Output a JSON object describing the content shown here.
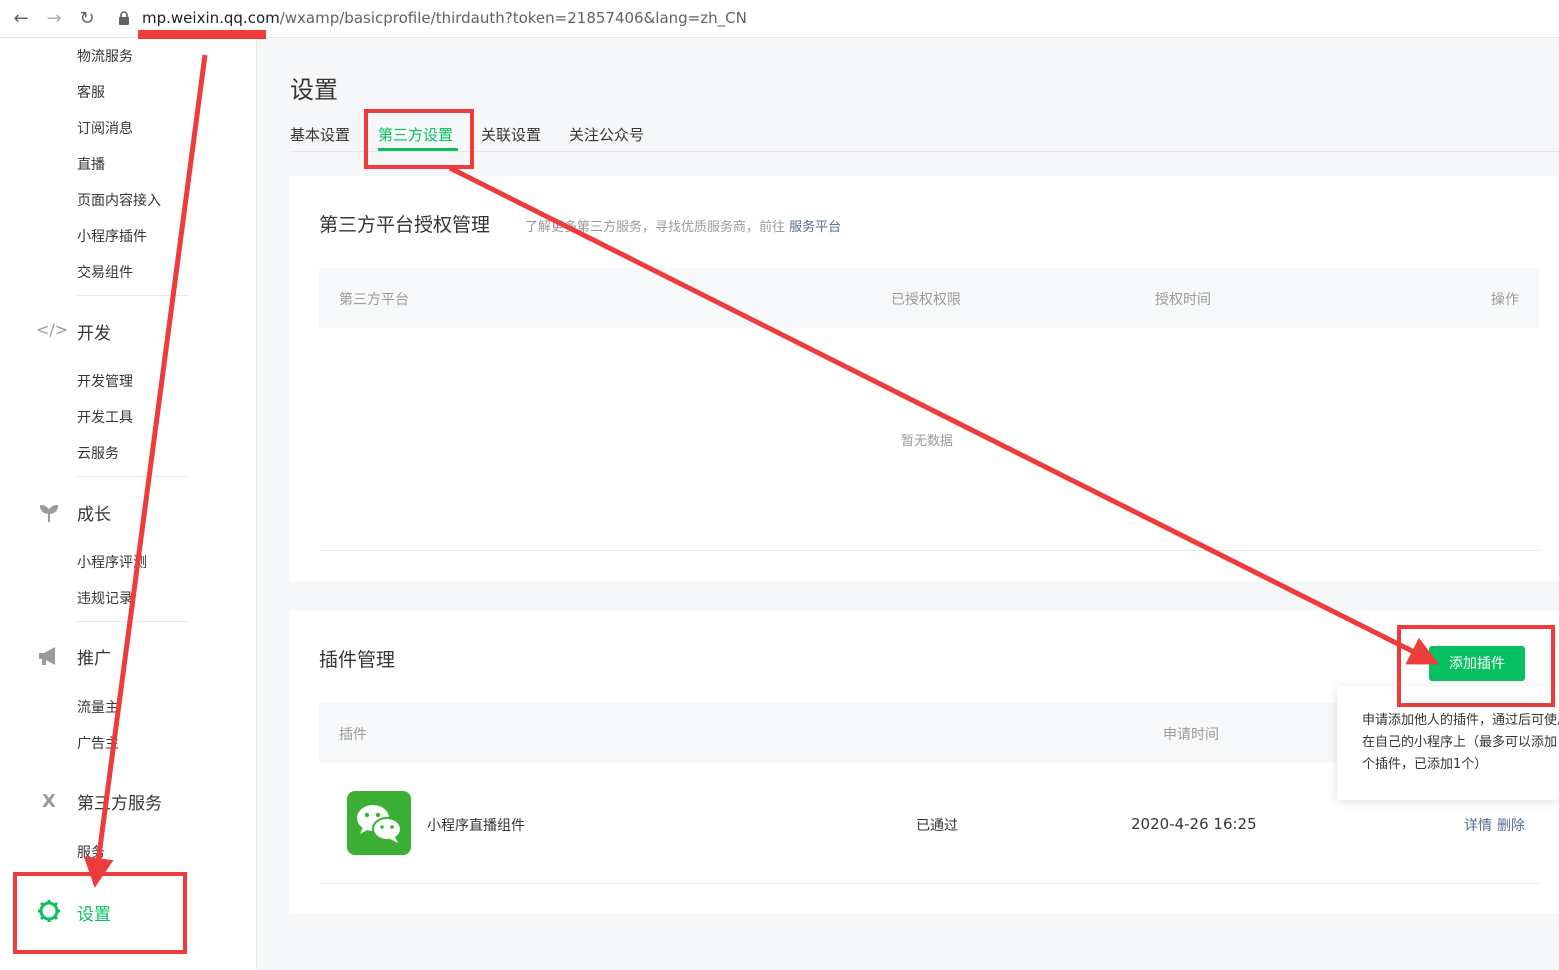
{
  "browser": {
    "url_host": "mp.weixin.qq.com",
    "url_path": "/wxamp/basicprofile/thirdauth?token=21857406&lang=zh_CN"
  },
  "sidebar": {
    "items": [
      "物流服务",
      "客服",
      "订阅消息",
      "直播",
      "页面内容接入",
      "小程序插件",
      "交易组件"
    ],
    "dev": {
      "title": "开发",
      "items": [
        "开发管理",
        "开发工具",
        "云服务"
      ]
    },
    "growth": {
      "title": "成长",
      "items": [
        "小程序评测",
        "违规记录"
      ]
    },
    "promo": {
      "title": "推广",
      "items": [
        "流量主",
        "广告主"
      ]
    },
    "third": {
      "title": "第三方服务",
      "items": [
        "服务"
      ]
    },
    "settings": "设置"
  },
  "page": {
    "title": "设置",
    "tabs": [
      "基本设置",
      "第三方设置",
      "关联设置",
      "关注公众号"
    ]
  },
  "auth": {
    "title": "第三方平台授权管理",
    "tip": "了解更多第三方服务，寻找优质服务商，前往",
    "tip_link": "服务平台",
    "columns": [
      "第三方平台",
      "已授权权限",
      "授权时间",
      "操作"
    ],
    "empty": "暂无数据"
  },
  "plugins": {
    "title": "插件管理",
    "add_button": "添加插件",
    "columns": [
      "插件",
      "申请时间"
    ],
    "rows": [
      {
        "name": "小程序直播组件",
        "status": "已通过",
        "time": "2020-4-26 16:25",
        "detail": "详情",
        "delete": "删除"
      }
    ]
  },
  "popover": {
    "lines": [
      "申请添加他人的插件，通过后可使用",
      "在自己的小程序上（最多可以添加",
      "个插件，已添加1个）"
    ]
  },
  "colors": {
    "accent": "#07c160",
    "link": "#576b95",
    "annotation": "#ee3b3b"
  }
}
